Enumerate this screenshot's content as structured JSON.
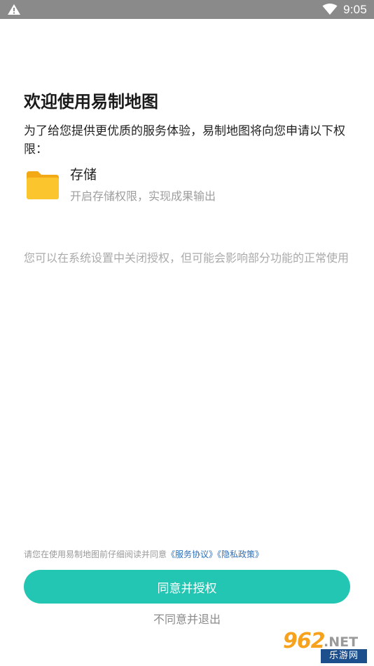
{
  "status_bar": {
    "time": "9:05",
    "left_icon": "warning-icon",
    "right_icon": "wifi-icon"
  },
  "main": {
    "title": "欢迎使用易制地图",
    "intro": "为了给您提供更优质的服务体验，易制地图将向您申请以下权限：",
    "permissions": [
      {
        "icon": "folder-icon",
        "name": "存储",
        "description": "开启存储权限，实现成果输出"
      }
    ],
    "note": "您可以在系统设置中关闭授权，但可能会影响部分功能的正常使用"
  },
  "footer": {
    "agreement_prefix": "请您在使用易制地图前仔细阅读并同意",
    "service_link": "《服务协议》",
    "privacy_link": "《隐私政策》",
    "agree_label": "同意并授权",
    "disagree_label": "不同意并退出"
  },
  "watermark": {
    "number": "962",
    "domain": ".NET",
    "site_name": "乐游网"
  },
  "colors": {
    "accent": "#23c6b2",
    "link": "#2d6fb8",
    "folder": "#fbc02d",
    "status_bar": "#8a8a8a"
  }
}
